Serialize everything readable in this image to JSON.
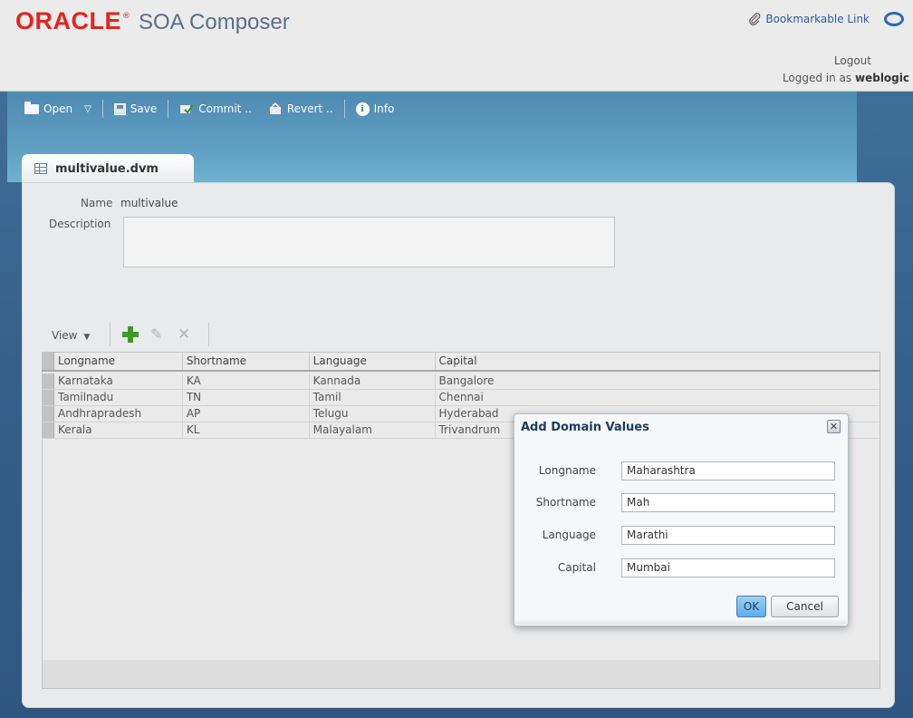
{
  "header": {
    "brand": "ORACLE",
    "trademark": "®",
    "app_name": "SOA Composer",
    "bookmark_link": "Bookmarkable Link",
    "logout": "Logout",
    "logged_in_prefix": "Logged in as",
    "username": "weblogic"
  },
  "toolbar": {
    "open_label": "Open",
    "save_label": "Save",
    "commit_label": "Commit ..",
    "revert_label": "Revert ..",
    "info_label": "Info"
  },
  "tab": {
    "label": "multivalue.dvm"
  },
  "form": {
    "name_label": "Name",
    "name_value": "multivalue",
    "description_label": "Description",
    "description_value": ""
  },
  "table_toolbar": {
    "view_label": "View"
  },
  "table": {
    "columns": [
      "Longname",
      "Shortname",
      "Language",
      "Capital"
    ],
    "rows": [
      [
        "Karnataka",
        "KA",
        "Kannada",
        "Bangalore"
      ],
      [
        "Tamilnadu",
        "TN",
        "Tamil",
        "Chennai"
      ],
      [
        "Andhrapradesh",
        "AP",
        "Telugu",
        "Hyderabad"
      ],
      [
        "Kerala",
        "KL",
        "Malayalam",
        "Trivandrum"
      ]
    ]
  },
  "dialog": {
    "title": "Add Domain Values",
    "fields": [
      {
        "label": "Longname",
        "value": "Maharashtra"
      },
      {
        "label": "Shortname",
        "value": "Mah"
      },
      {
        "label": "Language",
        "value": "Marathi"
      },
      {
        "label": "Capital",
        "value": "Mumbai"
      }
    ],
    "ok_label": "OK",
    "cancel_label": "Cancel"
  }
}
